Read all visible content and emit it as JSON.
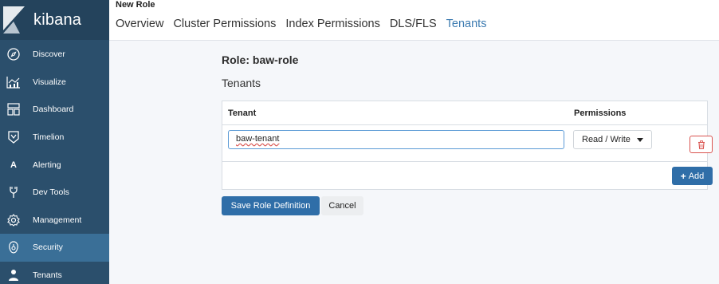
{
  "app": {
    "name": "kibana"
  },
  "sidebar": {
    "items": [
      {
        "label": "Discover",
        "icon": "compass-icon"
      },
      {
        "label": "Visualize",
        "icon": "bar-chart-icon"
      },
      {
        "label": "Dashboard",
        "icon": "dashboard-icon"
      },
      {
        "label": "Timelion",
        "icon": "timelion-icon"
      },
      {
        "label": "Alerting",
        "icon": "alerting-icon",
        "glyph": "A"
      },
      {
        "label": "Dev Tools",
        "icon": "wrench-icon"
      },
      {
        "label": "Management",
        "icon": "gear-icon"
      },
      {
        "label": "Security",
        "icon": "lock-icon"
      },
      {
        "label": "Tenants",
        "icon": "user-icon"
      }
    ]
  },
  "header": {
    "title": "New Role",
    "tabs": [
      "Overview",
      "Cluster Permissions",
      "Index Permissions",
      "DLS/FLS",
      "Tenants"
    ],
    "active_tab": "Tenants"
  },
  "main": {
    "role_title": "Role: baw-role",
    "section_title": "Tenants",
    "table": {
      "headers": {
        "tenant": "Tenant",
        "permissions": "Permissions"
      },
      "rows": [
        {
          "tenant": "baw-tenant",
          "permission": "Read / Write"
        }
      ]
    },
    "add_label": "Add",
    "save_label": "Save Role Definition",
    "cancel_label": "Cancel"
  },
  "colors": {
    "sidebar_bg": "#2b4f6c",
    "sidebar_active": "#3a6f97",
    "accent": "#2f6ea8",
    "tab_active": "#3b7ab0",
    "danger": "#d9534f"
  }
}
